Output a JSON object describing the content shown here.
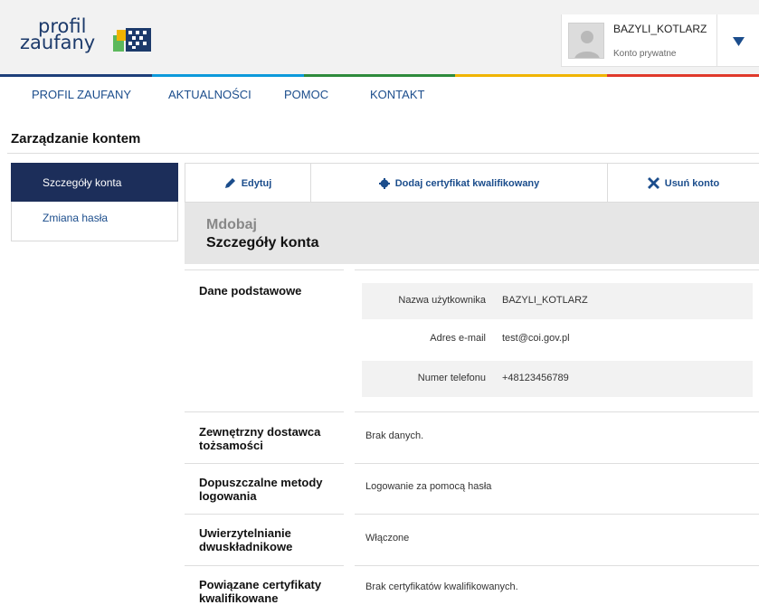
{
  "header": {
    "logo_line1": "profil",
    "logo_line2": "zaufany",
    "user": {
      "name": "BAZYLI_KOTLARZ",
      "account_type": "Konto prywatne"
    }
  },
  "colors": {
    "brand_navy": "#1c2e5a",
    "link_blue": "#1b4d8c",
    "bar": [
      "#1e3f7a",
      "#0d9adb",
      "#2e8b3c",
      "#f0b400",
      "#e0392b"
    ]
  },
  "nav": {
    "items": [
      "PROFIL ZAUFANY",
      "AKTUALNOŚCI",
      "POMOC",
      "KONTAKT"
    ]
  },
  "page": {
    "title": "Zarządzanie kontem"
  },
  "sidebar": {
    "items": [
      "Szczegóły konta",
      "Zmiana hasła"
    ]
  },
  "toolbar": {
    "edit": "Edytuj",
    "add_cert": "Dodaj certyfikat kwalifikowany",
    "delete": "Usuń konto",
    "icons": [
      "pencil-icon",
      "gear-icon",
      "close-icon"
    ]
  },
  "card": {
    "subtitle": "Mdobaj",
    "title": "Szczegóły konta"
  },
  "sections": {
    "basic": {
      "label": "Dane podstawowe",
      "fields": [
        {
          "key": "Nazwa użytkownika",
          "value": "BAZYLI_KOTLARZ"
        },
        {
          "key": "Adres e-mail",
          "value": "test@coi.gov.pl"
        },
        {
          "key": "Numer telefonu",
          "value": "+48123456789"
        }
      ]
    },
    "idp": {
      "label": "Zewnętrzny dostawca tożsamości",
      "value": "Brak danych."
    },
    "login_methods": {
      "label": "Dopuszczalne metody logowania",
      "value": "Logowanie za pomocą hasła"
    },
    "two_factor": {
      "label": "Uwierzytelnianie dwuskładnikowe",
      "value": "Włączone"
    },
    "certs": {
      "label": "Powiązane certyfikaty kwalifikowane",
      "value": "Brak certyfikatów kwalifikowanych."
    }
  }
}
